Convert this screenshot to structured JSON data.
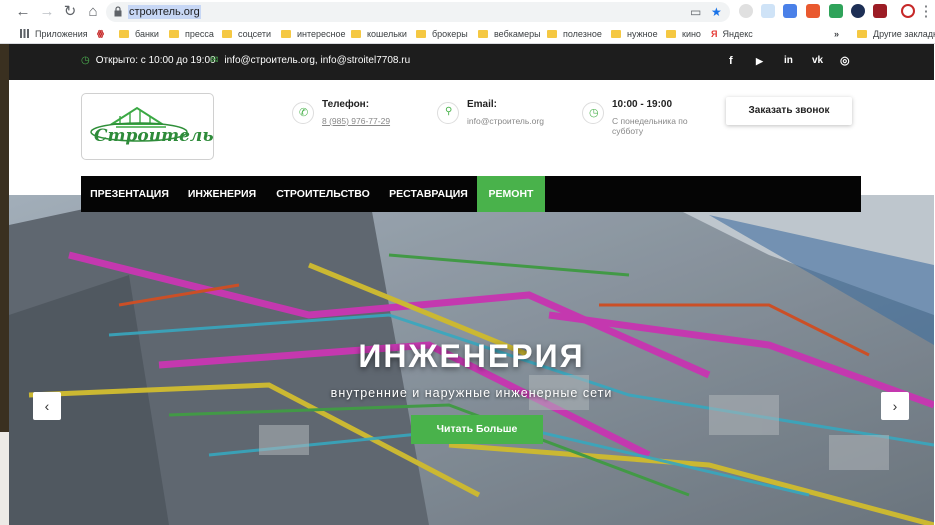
{
  "browser": {
    "url": "строитель.org",
    "bookmarks": [
      {
        "label": "Приложения",
        "icon": "apps-icon"
      },
      {
        "label": "",
        "icon": "site-icon"
      },
      {
        "label": "банки",
        "icon": "folder-icon"
      },
      {
        "label": "пресса",
        "icon": "folder-icon"
      },
      {
        "label": "соцсети",
        "icon": "folder-icon"
      },
      {
        "label": "интересное",
        "icon": "folder-icon"
      },
      {
        "label": "кошельки",
        "icon": "folder-icon"
      },
      {
        "label": "брокеры",
        "icon": "folder-icon"
      },
      {
        "label": "вебкамеры",
        "icon": "folder-icon"
      },
      {
        "label": "полезное",
        "icon": "folder-icon"
      },
      {
        "label": "нужное",
        "icon": "folder-icon"
      },
      {
        "label": "кино",
        "icon": "folder-icon"
      },
      {
        "label": "Яндекс",
        "icon": "yandex-icon"
      }
    ],
    "more": "»",
    "other_bookmarks": "Другие закладки"
  },
  "topbar": {
    "hours": "Открыто: с 10:00 до 19:00",
    "emails": "info@строитель.org, info@stroitel7708.ru"
  },
  "header": {
    "logo_text": "Строитель",
    "phone": {
      "title": "Телефон:",
      "value": "8 (985) 976-77-29"
    },
    "email": {
      "title": "Email:",
      "value": "info@строитель.org"
    },
    "hours": {
      "title": "10:00 - 19:00",
      "line1": "С понедельника по",
      "line2": "субботу"
    },
    "call_button": "Заказать звонок"
  },
  "menu": [
    {
      "label": "ПРЕЗЕНТАЦИЯ",
      "active": false
    },
    {
      "label": "ИНЖЕНЕРИЯ",
      "active": false
    },
    {
      "label": "СТРОИТЕЛЬСТВО",
      "active": false
    },
    {
      "label": "РЕСТАВРАЦИЯ",
      "active": false
    },
    {
      "label": "РЕМОНТ",
      "active": true
    }
  ],
  "hero": {
    "title": "ИНЖЕНЕРИЯ",
    "subtitle": "внутренние и наружные инженерные сети",
    "button": "Читать Больше"
  },
  "colors": {
    "accent": "#49b24b",
    "topbar": "#1d1d1d",
    "menu": "#050505"
  }
}
